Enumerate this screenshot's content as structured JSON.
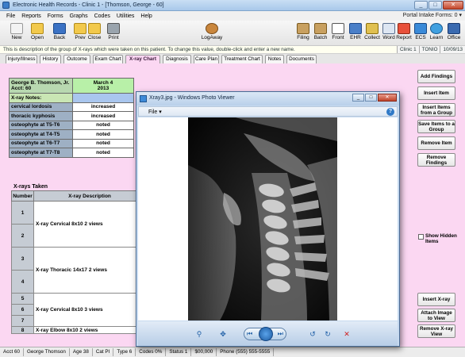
{
  "window": {
    "title": "Electronic Health Records - Clinic 1 - [Thomson, George - 60]",
    "min": "_",
    "max": "□",
    "close": "✕"
  },
  "menu": [
    "File",
    "Reports",
    "Forms",
    "Graphs",
    "Codes",
    "Utilities",
    "Help"
  ],
  "portal_text": "Portal Intake Forms: 0 ▾",
  "toolbar": {
    "left": [
      {
        "label": "New",
        "icon": "new-icon"
      },
      {
        "label": "Open",
        "icon": "open-folder-icon"
      },
      {
        "label": "Back",
        "icon": "back-arrow-icon"
      },
      {
        "label": "Prev",
        "icon": "prev-icon"
      },
      {
        "label": "Close",
        "icon": "close-folder-icon"
      },
      {
        "label": "Print",
        "icon": "printer-icon"
      }
    ],
    "center": {
      "label": "LogAway",
      "icon": "logaway-icon"
    },
    "right": [
      {
        "label": "Filing",
        "icon": "filing-icon"
      },
      {
        "label": "Batch",
        "icon": "batch-icon"
      },
      {
        "label": "Front",
        "icon": "calendar-icon"
      },
      {
        "label": "EHR",
        "icon": "ehr-icon"
      },
      {
        "label": "Collect",
        "icon": "collect-icon"
      },
      {
        "label": "Word",
        "icon": "word-icon"
      },
      {
        "label": "Report",
        "icon": "report-icon"
      },
      {
        "label": "ECS",
        "icon": "ecs-icon"
      },
      {
        "label": "Learn",
        "icon": "learn-icon"
      },
      {
        "label": "Office",
        "icon": "office-icon"
      }
    ]
  },
  "info": {
    "message": "This is description of the group of X-rays which were taken on this patient. To change this value, double-click and enter a new name.",
    "clinic": "Clinic 1",
    "user": "TONIO",
    "date": "10/09/13"
  },
  "tabs": [
    "Injury/Illness",
    "History",
    "Outcome",
    "Exam Chart",
    "X-ray Chart",
    "Diagnosis",
    "Care Plan",
    "Treatment Chart",
    "Notes",
    "Documents"
  ],
  "findings": {
    "patient_line1": "George B. Thomson, Jr.",
    "patient_line2": "Acct: 60",
    "date_line1": "March 4",
    "date_line2": "2013",
    "notes_label": "X-ray Notes:",
    "rows": [
      {
        "label": "cervical lordosis",
        "value": "increased"
      },
      {
        "label": "thoracic kyphosis",
        "value": "increased"
      },
      {
        "label": "osteophyte at T5-T6",
        "value": "noted"
      },
      {
        "label": "osteophyte at T4-T5",
        "value": "noted"
      },
      {
        "label": "osteophyte at T6-T7",
        "value": "noted"
      },
      {
        "label": "osteophyte at T7-T8",
        "value": "noted"
      }
    ]
  },
  "xrays": {
    "title": "X-rays Taken",
    "headers": [
      "Number",
      "X-ray Description"
    ],
    "rows": [
      {
        "num": "1",
        "desc": ""
      },
      {
        "num": "2",
        "desc": "X-ray Cervical 8x10 2 views"
      },
      {
        "num": "3",
        "desc": ""
      },
      {
        "num": "4",
        "desc": "X-ray Thoracic 14x17 2 views"
      },
      {
        "num": "5",
        "desc": ""
      },
      {
        "num": "6",
        "desc": "X-ray Cervical 8x10 3 views"
      },
      {
        "num": "7",
        "desc": ""
      },
      {
        "num": "8",
        "desc": "X-ray Elbow 8x10 2 views"
      }
    ]
  },
  "side_buttons": {
    "add_findings": "Add Findings",
    "insert_item": "Insert Item",
    "insert_items_group": "Insert Items from a Group",
    "save_items_group": "Save Items to a Group",
    "remove_item": "Remove Item",
    "remove_findings": "Remove Findings",
    "show_hidden": "Show Hidden Items",
    "insert_xray": "Insert X-ray",
    "attach_image": "Attach Image to View",
    "remove_xray": "Remove X-ray View"
  },
  "status": [
    "Acct 60",
    "George Thomson",
    "Age 38",
    "Cat PI",
    "Type 6",
    "Codes 0%",
    "Status 1",
    "$00,000",
    "Phone (555) 555-5555"
  ],
  "viewer": {
    "title": "Xray3.jpg - Windows Photo Viewer",
    "file_menu": "File ▾",
    "help": "?"
  }
}
